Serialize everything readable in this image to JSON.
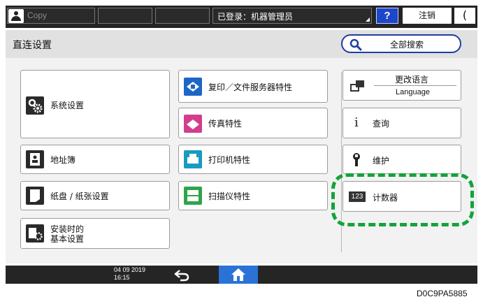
{
  "topbar": {
    "copy_label": "Copy",
    "login_status": "已登录：机器管理员",
    "help_label": "?",
    "logout_label": "注销",
    "sleep_label": "(",
    "icons": {
      "user": "user-icon",
      "sleep": "moon-icon"
    }
  },
  "header": {
    "title": "直连设置",
    "search_all_label": "全部搜索",
    "search_icon": "search-icon"
  },
  "left_column": [
    {
      "label": "系统设置",
      "icon": "gears-icon"
    },
    {
      "label": "地址簿",
      "icon": "address-book-icon"
    },
    {
      "label": "纸盘 / 纸张设置",
      "icon": "paper-tray-icon"
    },
    {
      "label_line1": "安装时的",
      "label_line2": "基本设置",
      "icon": "initial-setup-icon"
    }
  ],
  "middle_column": [
    {
      "label": "复印／文件服务器特性",
      "icon": "copier-icon"
    },
    {
      "label": "传真特性",
      "icon": "fax-icon"
    },
    {
      "label": "打印机特性",
      "icon": "printer-icon"
    },
    {
      "label": "扫描仪特性",
      "icon": "scanner-icon"
    }
  ],
  "right_column": {
    "change_language_line1": "更改语言",
    "change_language_line2": "Language",
    "inquiry_label": "查询",
    "maintenance_label": "维护",
    "counter_label": "计数器",
    "counter_icon_text": "123"
  },
  "bottombar": {
    "date": "04 09 2019",
    "time": "16:15",
    "back_icon": "back-arrow-icon",
    "home_icon": "home-icon"
  },
  "figure_code": "D0C9PA5885",
  "colors": {
    "accent_blue": "#1d46c8",
    "highlight_green": "#13a33a",
    "home_blue": "#2a72d6"
  }
}
